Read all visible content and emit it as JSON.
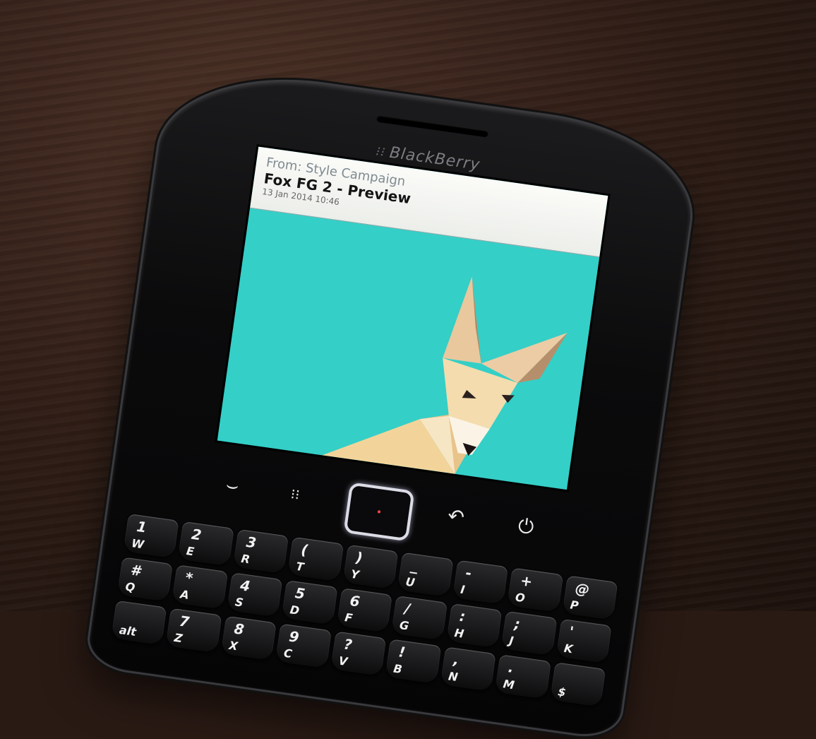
{
  "device": {
    "brand": "BlackBerry",
    "logo_icon": "blackberry-logo-icon"
  },
  "email": {
    "from": "From: Style Campaign",
    "subject": "Fox FG 2 - Preview",
    "date": "13 Jan 2014 10:46"
  },
  "nav": {
    "call": "call-icon",
    "menu": "blackberry-menu-icon",
    "back": "back-icon",
    "end": "end-call-power-icon"
  },
  "keys": [
    [
      {
        "top": "1",
        "bot": "W"
      },
      {
        "top": "2",
        "bot": "E"
      },
      {
        "top": "3",
        "bot": "R"
      },
      {
        "top": "(",
        "bot": "T"
      },
      {
        "top": ")",
        "bot": "Y"
      },
      {
        "top": "_",
        "bot": "U"
      },
      {
        "top": "-",
        "bot": "I"
      },
      {
        "top": "+",
        "bot": "O"
      },
      {
        "top": "@",
        "bot": "P"
      }
    ],
    [
      {
        "top": "#",
        "bot": "Q"
      },
      {
        "top": "*",
        "bot": "A"
      },
      {
        "top": "4",
        "bot": "S"
      },
      {
        "top": "5",
        "bot": "D"
      },
      {
        "top": "6",
        "bot": "F"
      },
      {
        "top": "/",
        "bot": "G"
      },
      {
        "top": ":",
        "bot": "H"
      },
      {
        "top": ";",
        "bot": "J"
      },
      {
        "top": "'",
        "bot": "K"
      }
    ],
    [
      {
        "top": "",
        "bot": "alt"
      },
      {
        "top": "7",
        "bot": "Z"
      },
      {
        "top": "8",
        "bot": "X"
      },
      {
        "top": "9",
        "bot": "C"
      },
      {
        "top": "?",
        "bot": "V"
      },
      {
        "top": "!",
        "bot": "B"
      },
      {
        "top": ",",
        "bot": "N"
      },
      {
        "top": ".",
        "bot": "M"
      },
      {
        "top": "",
        "bot": "$"
      }
    ]
  ],
  "colors": {
    "screen": "#34cfc7",
    "table": "#2c1b14"
  }
}
